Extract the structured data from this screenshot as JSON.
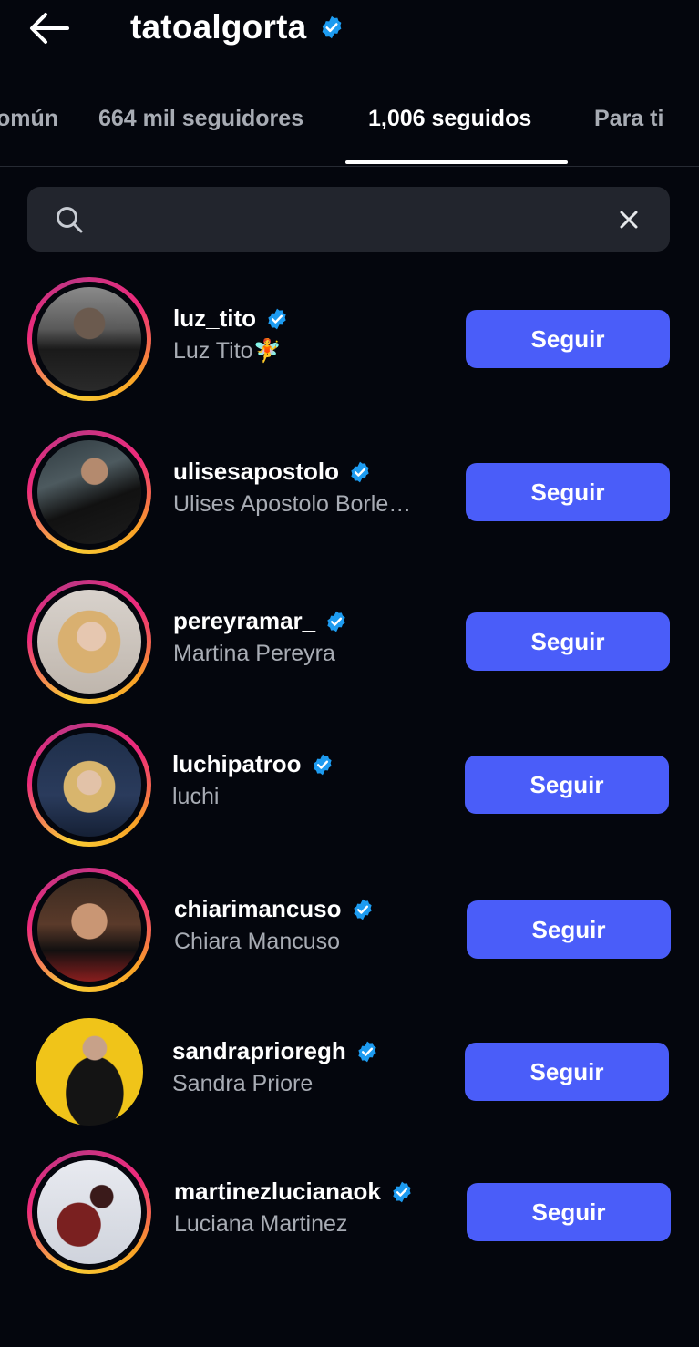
{
  "header": {
    "title": "tatoalgorta",
    "back_icon": "arrow-left-icon",
    "verified_icon": "verified-badge-icon"
  },
  "tabs": [
    {
      "label": "omún"
    },
    {
      "label": "664 mil seguidores"
    },
    {
      "label": "1,006 seguidos",
      "active": true
    },
    {
      "label": "Para ti"
    }
  ],
  "search": {
    "value": "",
    "icon": "search-icon",
    "clear_icon": "close-icon"
  },
  "users": [
    {
      "username": "luz_tito",
      "fullname": "Luz Tito🧚",
      "button": "Seguir",
      "story_ring": true
    },
    {
      "username": "ulisesapostolo",
      "fullname": "Ulises Apostolo Borle…",
      "button": "Seguir",
      "story_ring": true
    },
    {
      "username": "pereyramar_",
      "fullname": "Martina Pereyra",
      "button": "Seguir",
      "story_ring": true
    },
    {
      "username": "luchipatroo",
      "fullname": "luchi",
      "button": "Seguir",
      "story_ring": true
    },
    {
      "username": "chiarimancuso",
      "fullname": "Chiara Mancuso",
      "button": "Seguir",
      "story_ring": true
    },
    {
      "username": "sandraprioregh",
      "fullname": "Sandra Priore",
      "button": "Seguir",
      "story_ring": false
    },
    {
      "username": "martinezlucianaok",
      "fullname": "Luciana Martinez",
      "button": "Seguir",
      "story_ring": true
    }
  ],
  "colors": {
    "background": "#04060d",
    "button": "#4a5df9",
    "verified": "#1d9bf0",
    "secondary_text": "#a8acb4",
    "search_bg": "#22252d"
  }
}
